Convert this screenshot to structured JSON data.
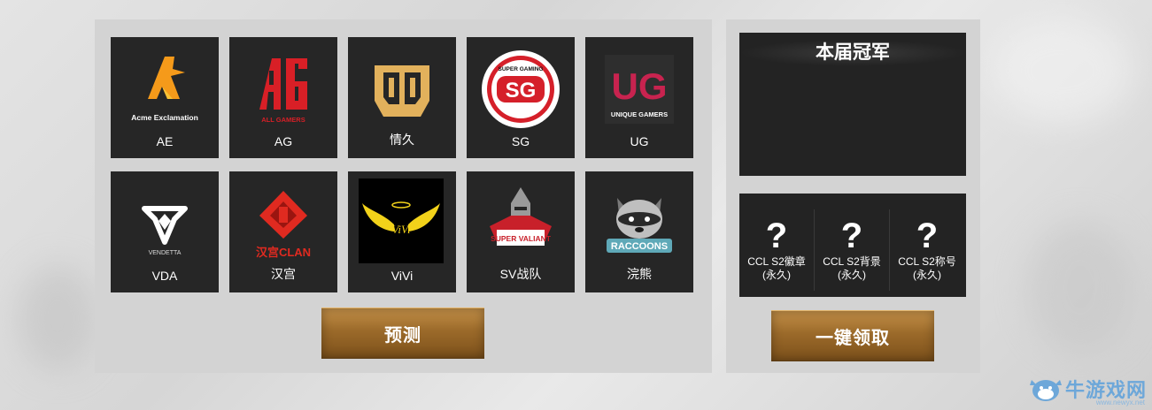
{
  "teams": [
    {
      "name": "AE",
      "logo_text": "Acme Exclamation",
      "logo_icon": "ae-flame-icon",
      "accent": "#f59a1a"
    },
    {
      "name": "AG",
      "logo_text": "ALL GAMERS",
      "logo_icon": "ag-logo-icon",
      "accent": "#d81f26"
    },
    {
      "name": "情久",
      "logo_text": "",
      "logo_icon": "qingjiu-shield-icon",
      "accent": "#e2b15c"
    },
    {
      "name": "SG",
      "logo_text": "SUPER GAMING",
      "logo_mark": "SG",
      "logo_icon": "sg-circle-icon",
      "accent": "#d5202a"
    },
    {
      "name": "UG",
      "logo_text": "UNIQUE GAMERS",
      "logo_mark": "UG",
      "logo_icon": "ug-logo-icon",
      "accent": "#c8234f"
    },
    {
      "name": "VDA",
      "logo_text": "VENDETTA",
      "logo_icon": "vda-logo-icon",
      "accent": "#ffffff"
    },
    {
      "name": "汉宫",
      "logo_text": "汉宫CLAN",
      "logo_icon": "hangong-logo-icon",
      "accent": "#e02a20"
    },
    {
      "name": "ViVi",
      "logo_text": "ViVi",
      "logo_icon": "vivi-wings-icon",
      "accent": "#f2d21a"
    },
    {
      "name": "SV战队",
      "logo_text": "SUPER VALIANT",
      "logo_icon": "sv-knight-icon",
      "accent": "#c8202a"
    },
    {
      "name": "浣熊",
      "logo_text": "RACCOONS",
      "logo_icon": "raccoon-icon",
      "accent": "#5fa9b8"
    }
  ],
  "predict_button": "预测",
  "champion": {
    "title": "本届冠军"
  },
  "rewards": [
    {
      "symbol": "?",
      "label_line1": "CCL S2徽章",
      "label_line2": "(永久)"
    },
    {
      "symbol": "?",
      "label_line1": "CCL S2背景",
      "label_line2": "(永久)"
    },
    {
      "symbol": "?",
      "label_line1": "CCL S2称号",
      "label_line2": "(永久)"
    }
  ],
  "claim_button": "一键领取",
  "watermark": {
    "text": "牛游戏网",
    "sub": "www.newyx.net"
  }
}
